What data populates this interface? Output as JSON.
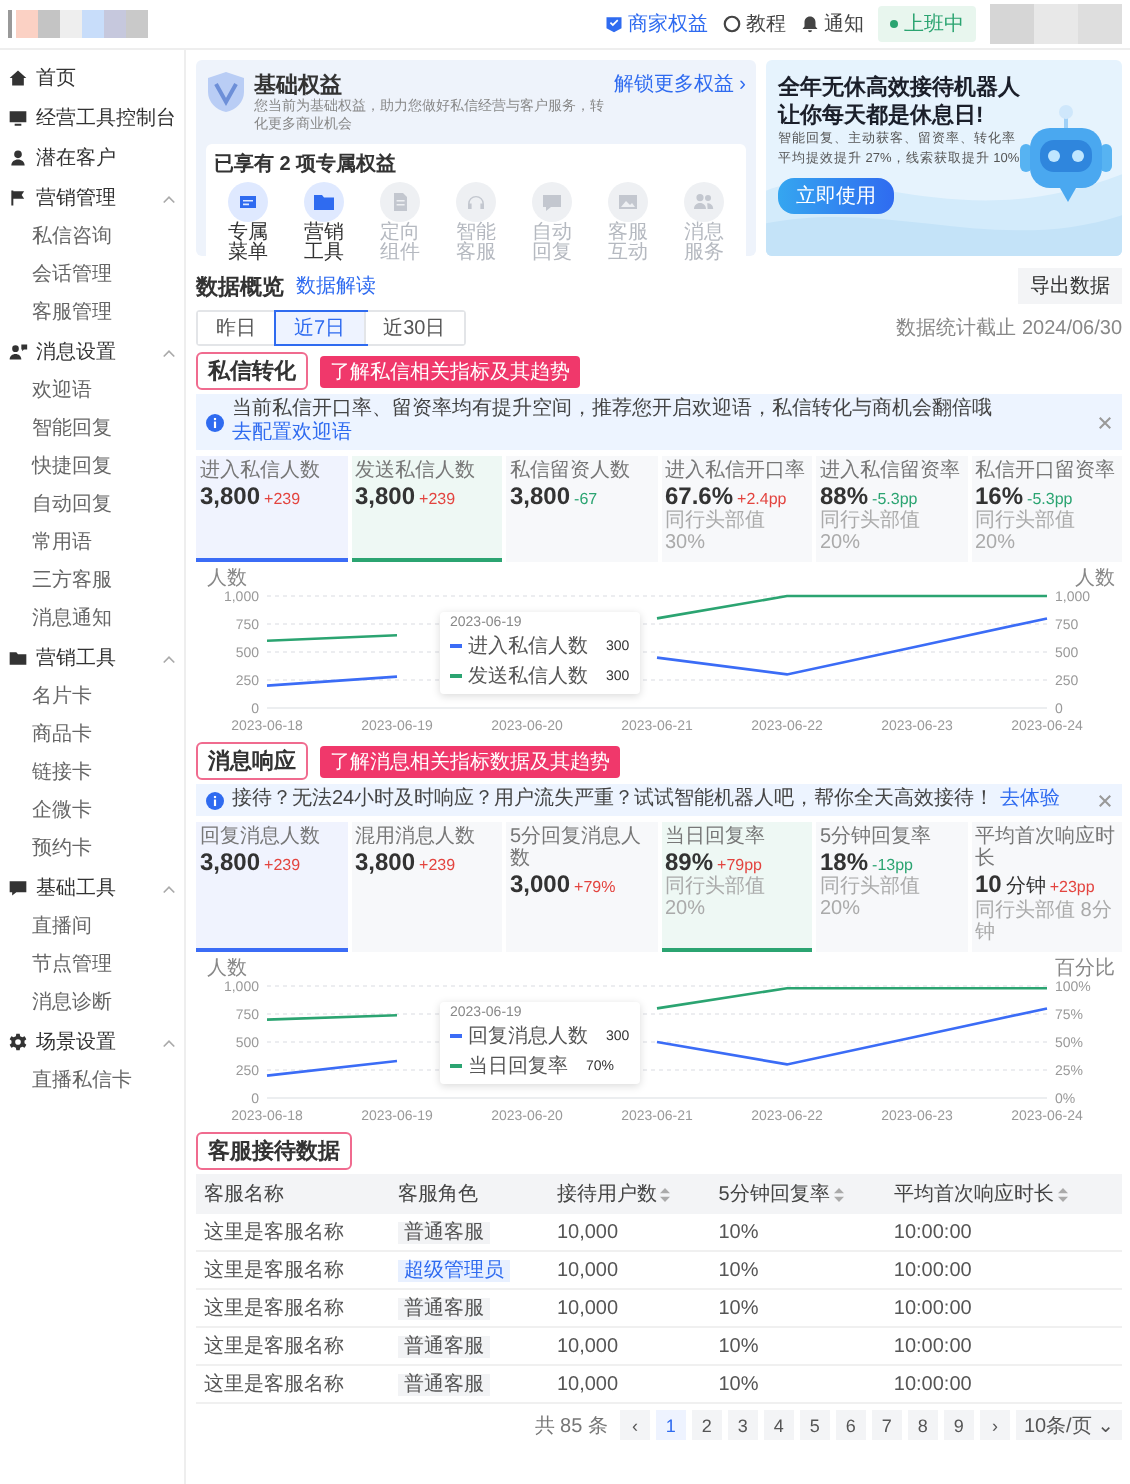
{
  "header": {
    "links": [
      {
        "label": "商家权益",
        "selected": true
      },
      {
        "label": "教程",
        "selected": false
      },
      {
        "label": "通知",
        "selected": false
      }
    ],
    "status": "上班中"
  },
  "sidebar": {
    "items": [
      {
        "label": "首页"
      },
      {
        "label": "经营工具控制台"
      },
      {
        "label": "潜在客户"
      },
      {
        "label": "营销管理",
        "expanded": true,
        "children": [
          {
            "label": "私信咨询"
          },
          {
            "label": "会话管理"
          },
          {
            "label": "客服管理"
          }
        ]
      },
      {
        "label": "消息设置",
        "expanded": true,
        "children": [
          {
            "label": "欢迎语"
          },
          {
            "label": "智能回复"
          },
          {
            "label": "快捷回复"
          },
          {
            "label": "自动回复"
          },
          {
            "label": "常用语"
          },
          {
            "label": "三方客服"
          },
          {
            "label": "消息通知"
          }
        ]
      },
      {
        "label": "营销工具",
        "expanded": true,
        "children": [
          {
            "label": "名片卡"
          },
          {
            "label": "商品卡"
          },
          {
            "label": "链接卡"
          },
          {
            "label": "企微卡"
          },
          {
            "label": "预约卡"
          }
        ]
      },
      {
        "label": "基础工具",
        "expanded": true,
        "children": [
          {
            "label": "直播间"
          },
          {
            "label": "节点管理"
          },
          {
            "label": "消息诊断"
          }
        ]
      },
      {
        "label": "场景设置",
        "expanded": true,
        "children": [
          {
            "label": "直播私信卡"
          }
        ]
      }
    ]
  },
  "banner": {
    "title": "基础权益",
    "description": "您当前为基础权益，助力您做好私信经营与客户服务，转化更多商业机会",
    "link": "解锁更多权益 ›",
    "owned": "已享有 2 项专属权益",
    "benefits": [
      {
        "label": "专属菜单",
        "enabled": true
      },
      {
        "label": "营销工具",
        "enabled": true
      },
      {
        "label": "定向组件",
        "enabled": false
      },
      {
        "label": "智能客服",
        "enabled": false
      },
      {
        "label": "自动回复",
        "enabled": false
      },
      {
        "label": "客服互动",
        "enabled": false
      },
      {
        "label": "消息服务",
        "enabled": false
      }
    ]
  },
  "promo": {
    "headline": [
      "全年无休高效接待机器人",
      "让你每天都是休息日!"
    ],
    "lines": [
      "智能回复、主动获客、留资率、转化率",
      "平均提效提升 27%，线索获取提升 10%"
    ],
    "button": "立即使用"
  },
  "overview": {
    "title": "数据概览",
    "link": "数据解读",
    "export": "导出数据",
    "ranges": [
      {
        "label": "昨日",
        "selected": false
      },
      {
        "label": "近7日",
        "selected": true
      },
      {
        "label": "近30日",
        "selected": false
      }
    ],
    "updated": "数据统计截止 2024/06/30"
  },
  "sections": [
    {
      "title": "私信转化",
      "hint": "了解私信相关指标及其趋势",
      "notice": {
        "text": "当前私信开口率、留资率均有提升空间，推荐您开启欢迎语，私信转化与商机会翻倍哦",
        "link": "去配置欢迎语"
      },
      "metrics": [
        {
          "label": "进入私信人数",
          "value": "3,800",
          "delta": "+239",
          "rising": true,
          "selected": true
        },
        {
          "label": "发送私信人数",
          "value": "3,800",
          "delta": "+239",
          "rising": true,
          "selected": true
        },
        {
          "label": "私信留资人数",
          "value": "3,800",
          "delta": "-67",
          "rising": false,
          "selected": false
        },
        {
          "label": "进入私信开口率",
          "value": "67.6%",
          "delta": "+2.4pp",
          "rising": true,
          "benchmark": "同行头部值 30%",
          "selected": false
        },
        {
          "label": "进入私信留资率",
          "value": "88%",
          "delta": "-5.3pp",
          "rising": false,
          "benchmark": "同行头部值 20%",
          "selected": false
        },
        {
          "label": "私信开口留资率",
          "value": "16%",
          "delta": "-5.3pp",
          "rising": false,
          "benchmark": "同行头部值 20%",
          "selected": false
        }
      ],
      "chart_data": {
        "type": "line",
        "ylabel": "人数",
        "categories": [
          "2023-06-18",
          "2023-06-19",
          "2023-06-20",
          "2023-06-21",
          "2023-06-22",
          "2023-06-23",
          "2023-06-24"
        ],
        "ylim": [
          0,
          1000
        ],
        "yticks": [
          0,
          250,
          500,
          750,
          {
            "value": 1000,
            "label": "1,000"
          }
        ],
        "grid": true,
        "legend": true,
        "series": [
          {
            "name": "进入私信人数",
            "color": "#3b6cf6",
            "values": [
              200,
              280,
              null,
              450,
              300,
              550,
              800
            ]
          },
          {
            "name": "发送私信人数",
            "color": "#2ba471",
            "values": [
              600,
              650,
              null,
              800,
              1000,
              1000,
              1000
            ]
          }
        ]
      },
      "right_axis": {
        "title": "人数",
        "ticks": [
          "1,000",
          "750",
          "500",
          "250",
          "0"
        ]
      },
      "tooltip": {
        "date": "2023-06-19",
        "values": [
          "300",
          "300"
        ]
      }
    },
    {
      "title": "消息响应",
      "hint": "了解消息相关指标数据及其趋势",
      "notice": {
        "text": "接待？无法24小时及时响应？用户流失严重？试试智能机器人吧，帮你全天高效接待！",
        "link": "去体验"
      },
      "metrics": [
        {
          "label": "回复消息人数",
          "value": "3,800",
          "delta": "+239",
          "rising": true,
          "selected": true
        },
        {
          "label": "混用消息人数",
          "value": "3,800",
          "delta": "+239",
          "rising": true,
          "selected": false
        },
        {
          "label": "5分回复消息人数",
          "value": "3,000",
          "delta": "+79%",
          "rising": true,
          "selected": false
        },
        {
          "label": "当日回复率",
          "value": "89%",
          "delta": "+79pp",
          "rising": true,
          "benchmark": "同行头部值 20%",
          "selected": true
        },
        {
          "label": "5分钟回复率",
          "value": "18%",
          "delta": "-13pp",
          "rising": false,
          "benchmark": "同行头部值 20%",
          "selected": false
        },
        {
          "label": "平均首次响应时长",
          "value": "10",
          "unit": "分钟",
          "delta": "+23pp",
          "rising": true,
          "benchmark": "同行头部值 8分钟",
          "selected": false
        }
      ],
      "chart_data": {
        "type": "line",
        "ylabel": "人数",
        "categories": [
          "2023-06-18",
          "2023-06-19",
          "2023-06-20",
          "2023-06-21",
          "2023-06-22",
          "2023-06-23",
          "2023-06-24"
        ],
        "ylim": [
          0,
          1000
        ],
        "yticks": [
          0,
          250,
          500,
          750,
          {
            "value": 1000,
            "label": "1,000"
          }
        ],
        "grid": true,
        "legend": true,
        "series": [
          {
            "name": "回复消息人数",
            "color": "#3b6cf6",
            "values": [
              200,
              330,
              null,
              500,
              300,
              550,
              800
            ]
          },
          {
            "name": "当日回复率",
            "color": "#2ba471",
            "values": [
              700,
              740,
              null,
              800,
              980,
              980,
              980
            ]
          }
        ]
      },
      "right_axis": {
        "title": "百分比",
        "ticks": [
          "100%",
          "75%",
          "50%",
          "25%",
          "0%"
        ]
      },
      "tooltip": {
        "date": "2023-06-19",
        "values": [
          "300",
          "70%"
        ]
      }
    }
  ],
  "table": {
    "title": "客服接待数据",
    "columns": [
      {
        "label": "客服名称",
        "sortable": false
      },
      {
        "label": "客服角色",
        "sortable": false
      },
      {
        "label": "接待用户数",
        "sortable": true
      },
      {
        "label": "5分钟回复率",
        "sortable": true
      },
      {
        "label": "平均首次响应时长",
        "sortable": true
      }
    ],
    "rows": [
      {
        "name": "这里是客服名称",
        "role": "普通客服",
        "kind": "normal",
        "users": "10,000",
        "rate": "10%",
        "duration": "10:00:00"
      },
      {
        "name": "这里是客服名称",
        "role": "超级管理员",
        "kind": "admin",
        "users": "10,000",
        "rate": "10%",
        "duration": "10:00:00"
      },
      {
        "name": "这里是客服名称",
        "role": "普通客服",
        "kind": "normal",
        "users": "10,000",
        "rate": "10%",
        "duration": "10:00:00"
      },
      {
        "name": "这里是客服名称",
        "role": "普通客服",
        "kind": "normal",
        "users": "10,000",
        "rate": "10%",
        "duration": "10:00:00"
      },
      {
        "name": "这里是客服名称",
        "role": "普通客服",
        "kind": "normal",
        "users": "10,000",
        "rate": "10%",
        "duration": "10:00:00"
      }
    ]
  },
  "pagination": {
    "total": "共 85 条",
    "prev": "‹",
    "next": "›",
    "pages": [
      {
        "label": "1",
        "selected": true
      },
      {
        "label": "2",
        "selected": false
      },
      {
        "label": "3",
        "selected": false
      },
      {
        "label": "4",
        "selected": false
      },
      {
        "label": "5",
        "selected": false
      },
      {
        "label": "6",
        "selected": false
      },
      {
        "label": "7",
        "selected": false
      },
      {
        "label": "8",
        "selected": false
      },
      {
        "label": "9",
        "selected": false
      }
    ],
    "page_size": "10条/页 ⌄"
  }
}
